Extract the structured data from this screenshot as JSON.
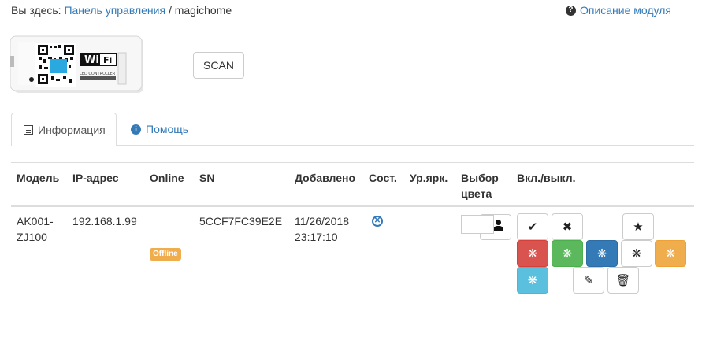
{
  "breadcrumb": {
    "prefix": "Вы здесь:",
    "link": "Панель управления",
    "separator": "/",
    "current": "magichome"
  },
  "module_link": {
    "label": "Описание модуля",
    "icon": "question-circle-icon"
  },
  "device_image": {
    "brand_text": "WiFi",
    "caption": "LED CONTROLLER"
  },
  "scan_label": "SCAN",
  "tabs": [
    {
      "label": "Информация",
      "icon": "list-icon",
      "active": true
    },
    {
      "label": "Помощь",
      "icon": "info-icon",
      "active": false
    }
  ],
  "table": {
    "headers": [
      "Модель",
      "IP-адрес",
      "Online",
      "SN",
      "Добавлено",
      "Сост.",
      "Ур.ярк.",
      "Выбор цвета",
      "Вкл./выкл."
    ],
    "row": {
      "model": "AK001-ZJ100",
      "ip": "192.168.1.99",
      "online_badge": "Offline",
      "sn": "5CCF7FC39E2E",
      "added_date": "11/26/2018",
      "added_time": "23:17:10",
      "state_icon": "times-circle-icon",
      "brightness": ""
    }
  },
  "colors": {
    "link": "#337ab7",
    "red": "#d9534f",
    "green": "#5cb85c",
    "blue": "#337ab7",
    "orange": "#f0ad4e",
    "cyan": "#5bc0de"
  },
  "actions": {
    "on": "✔",
    "off": "✖",
    "favorite": "★",
    "color_glyph": "❋",
    "edit": "✎",
    "delete": "🗑"
  }
}
